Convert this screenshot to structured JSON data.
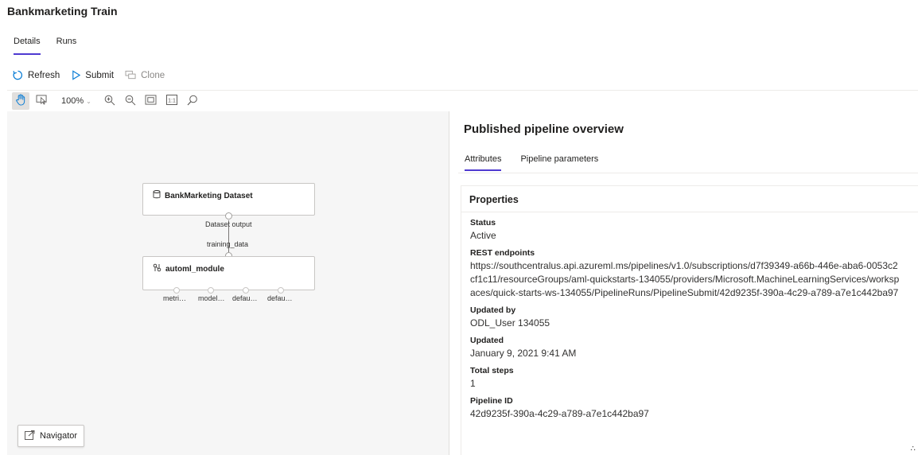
{
  "page": {
    "title": "Bankmarketing Train"
  },
  "tabs": [
    {
      "label": "Details",
      "active": true
    },
    {
      "label": "Runs",
      "active": false
    }
  ],
  "commands": {
    "refresh": "Refresh",
    "submit": "Submit",
    "clone": "Clone"
  },
  "toolbar": {
    "zoom": "100%",
    "icons": [
      "hand-pan-icon",
      "select-icon",
      "zoom-in-icon",
      "zoom-out-icon",
      "fit-screen-icon",
      "actual-size-icon",
      "search-icon"
    ]
  },
  "graph": {
    "dataset_node": {
      "title": "BankMarketing Dataset",
      "output_label": "Dataset output"
    },
    "input_label": "training_data",
    "module_node": {
      "title": "automl_module",
      "outputs": [
        "metri…",
        "model…",
        "defau…",
        "defau…"
      ]
    },
    "navigator": "Navigator"
  },
  "panel": {
    "title": "Published pipeline overview",
    "tabs": [
      {
        "label": "Attributes",
        "active": true
      },
      {
        "label": "Pipeline parameters",
        "active": false
      }
    ],
    "properties_header": "Properties",
    "properties": [
      {
        "label": "Status",
        "value": "Active"
      },
      {
        "label": "REST endpoints",
        "value": "https://southcentralus.api.azureml.ms/pipelines/v1.0/subscriptions/d7f39349-a66b-446e-aba6-0053c2cf1c11/resourceGroups/aml-quickstarts-134055/providers/Microsoft.MachineLearningServices/workspaces/quick-starts-ws-134055/PipelineRuns/PipelineSubmit/42d9235f-390a-4c29-a789-a7e1c442ba97"
      },
      {
        "label": "Updated by",
        "value": "ODL_User 134055"
      },
      {
        "label": "Updated",
        "value": "January 9, 2021 9:41 AM"
      },
      {
        "label": "Total steps",
        "value": "1"
      },
      {
        "label": "Pipeline ID",
        "value": "42d9235f-390a-4c29-a789-a7e1c442ba97"
      }
    ]
  },
  "colors": {
    "accent": "#4f3ad1",
    "canvas": "#f6f6f6",
    "link": "#0078d4"
  }
}
